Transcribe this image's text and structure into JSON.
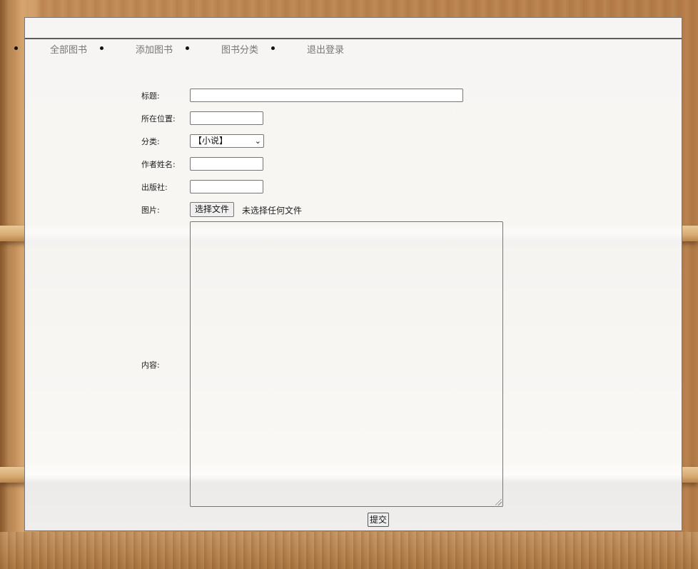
{
  "nav": {
    "items": [
      {
        "label": "全部图书"
      },
      {
        "label": "添加图书"
      },
      {
        "label": "图书分类"
      },
      {
        "label": "退出登录"
      }
    ]
  },
  "form": {
    "title_label": "标题:",
    "title_value": "",
    "location_label": "所在位置:",
    "location_value": "",
    "category_label": "分类:",
    "category_selected": "【小说】",
    "author_label": "作者姓名:",
    "author_value": "",
    "publisher_label": "出版社:",
    "publisher_value": "",
    "image_label": "图片:",
    "file_button_label": "选择文件",
    "file_status": "未选择任何文件",
    "content_label": "内容:",
    "content_value": "",
    "submit_label": "提交"
  },
  "colors": {
    "nav_link": "#777777",
    "border": "#767676"
  }
}
